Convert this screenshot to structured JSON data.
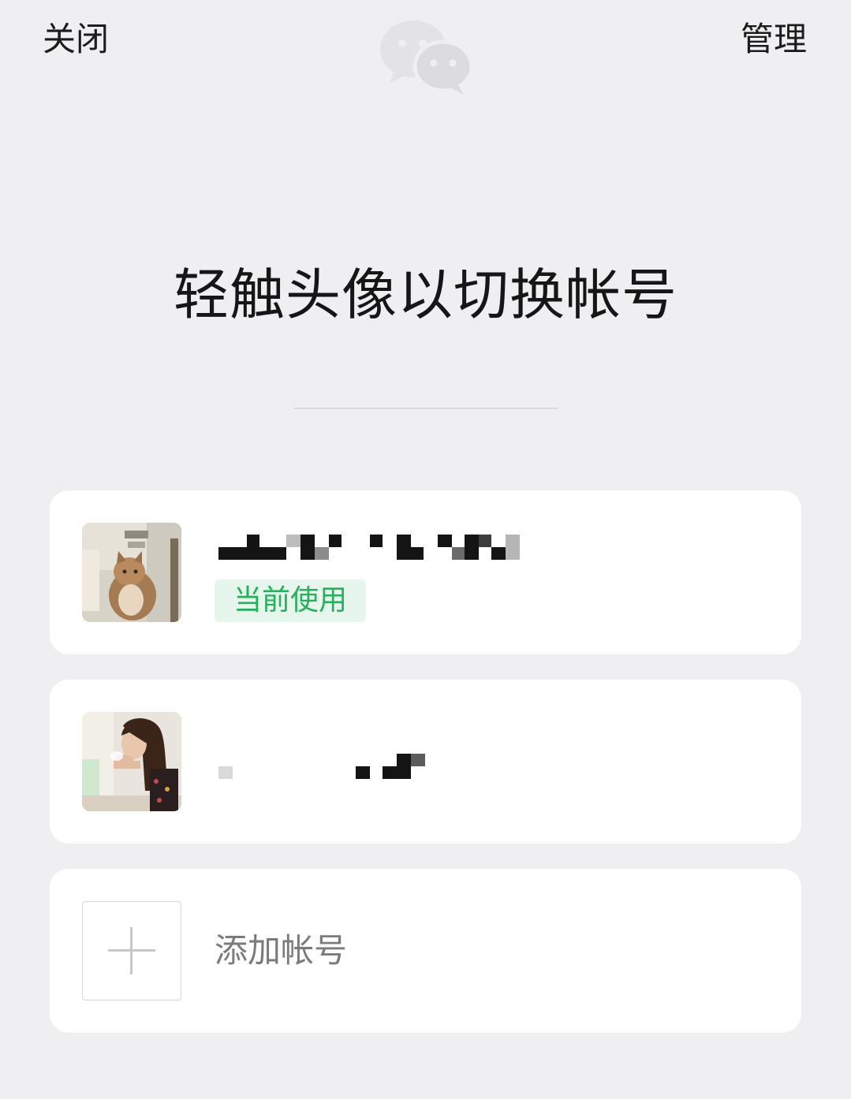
{
  "header": {
    "close_label": "关闭",
    "manage_label": "管理",
    "logo_icon": "wechat-logo-icon"
  },
  "headline": "轻触头像以切换帐号",
  "accounts": [
    {
      "avatar_icon": "cat-photo-avatar",
      "status_badge": "当前使用"
    },
    {
      "avatar_icon": "woman-photo-avatar"
    }
  ],
  "add_account": {
    "label": "添加帐号",
    "icon": "plus-icon"
  },
  "colors": {
    "background": "#efeff1",
    "card": "#ffffff",
    "accent_green": "#25b05b",
    "badge_bg": "#e7f6ec",
    "muted_text": "#7b7b7b"
  }
}
